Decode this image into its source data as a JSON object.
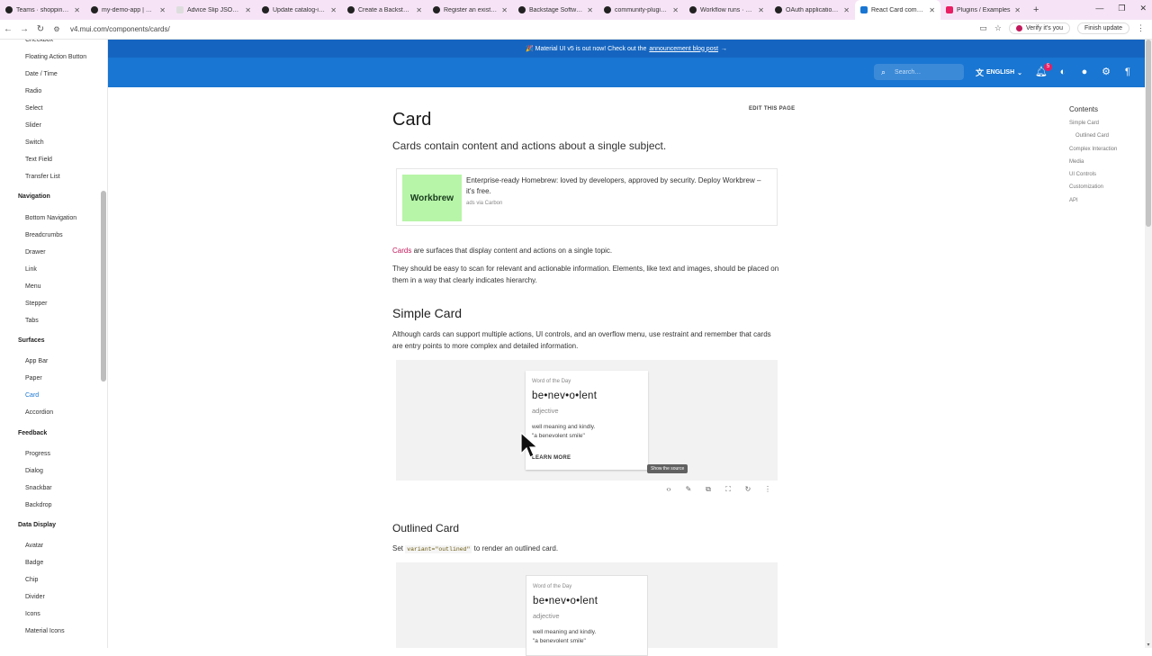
{
  "browser": {
    "tabs": [
      {
        "title": "Teams · shopping-hub",
        "icon": "github-icon"
      },
      {
        "title": "my-demo-app | Overview",
        "icon": "github-icon"
      },
      {
        "title": "Advice Slip JSON API",
        "icon": "blank-page-icon"
      },
      {
        "title": "Update catalog-info.yaml",
        "icon": "github-icon"
      },
      {
        "title": "Create a Backstage Plugin",
        "icon": "backstage-icon"
      },
      {
        "title": "Register an existing component",
        "icon": "backstage-icon"
      },
      {
        "title": "Backstage Software Catalog",
        "icon": "backstage-icon"
      },
      {
        "title": "community-plugins/workspaces",
        "icon": "github-icon"
      },
      {
        "title": "Workflow runs · Sanjeev",
        "icon": "github-icon"
      },
      {
        "title": "OAuth application settings",
        "icon": "github-icon"
      },
      {
        "title": "React Card component",
        "icon": "mui-icon",
        "active": true
      },
      {
        "title": "Plugins / Examples",
        "icon": "figma-icon"
      }
    ],
    "url": "v4.mui.com/components/cards/",
    "verify_label": "Verify it's you",
    "finish_update_label": "Finish update"
  },
  "banner": {
    "prefix": "🎉 Material UI v5 is out now! Check out the",
    "link": "announcement blog post",
    "suffix": "→"
  },
  "appbar": {
    "search_placeholder": "Search…",
    "language": "ENGLISH",
    "notifications_count": "5"
  },
  "sidenav": {
    "items": [
      {
        "label": "Checkbox",
        "type": "item"
      },
      {
        "label": "Floating Action Button",
        "type": "item"
      },
      {
        "label": "Date / Time",
        "type": "item"
      },
      {
        "label": "Radio",
        "type": "item"
      },
      {
        "label": "Select",
        "type": "item"
      },
      {
        "label": "Slider",
        "type": "item"
      },
      {
        "label": "Switch",
        "type": "item"
      },
      {
        "label": "Text Field",
        "type": "item"
      },
      {
        "label": "Transfer List",
        "type": "item"
      },
      {
        "label": "Navigation",
        "type": "group"
      },
      {
        "label": "Bottom Navigation",
        "type": "item"
      },
      {
        "label": "Breadcrumbs",
        "type": "item"
      },
      {
        "label": "Drawer",
        "type": "item"
      },
      {
        "label": "Link",
        "type": "item"
      },
      {
        "label": "Menu",
        "type": "item"
      },
      {
        "label": "Stepper",
        "type": "item"
      },
      {
        "label": "Tabs",
        "type": "item"
      },
      {
        "label": "Surfaces",
        "type": "group"
      },
      {
        "label": "App Bar",
        "type": "item"
      },
      {
        "label": "Paper",
        "type": "item"
      },
      {
        "label": "Card",
        "type": "item",
        "active": true
      },
      {
        "label": "Accordion",
        "type": "item"
      },
      {
        "label": "Feedback",
        "type": "group"
      },
      {
        "label": "Progress",
        "type": "item"
      },
      {
        "label": "Dialog",
        "type": "item"
      },
      {
        "label": "Snackbar",
        "type": "item"
      },
      {
        "label": "Backdrop",
        "type": "item"
      },
      {
        "label": "Data Display",
        "type": "group"
      },
      {
        "label": "Avatar",
        "type": "item"
      },
      {
        "label": "Badge",
        "type": "item"
      },
      {
        "label": "Chip",
        "type": "item"
      },
      {
        "label": "Divider",
        "type": "item"
      },
      {
        "label": "Icons",
        "type": "item"
      },
      {
        "label": "Material Icons",
        "type": "item"
      }
    ]
  },
  "main": {
    "title": "Card",
    "edit_label": "EDIT THIS PAGE",
    "lead": "Cards contain content and actions about a single subject.",
    "ad": {
      "logo_text": "Workbrew",
      "text": "Enterprise-ready Homebrew: loved by developers, approved by security. Deploy Workbrew – it's free.",
      "via": "ads via Carbon"
    },
    "intro_link": "Cards",
    "intro_rest": " are surfaces that display content and actions on a single topic.",
    "intro_p2": "They should be easy to scan for relevant and actionable information. Elements, like text and images, should be placed on them in a way that clearly indicates hierarchy.",
    "simple_heading": "Simple Card",
    "simple_desc": "Although cards can support multiple actions, UI controls, and an overflow menu, use restraint and remember that cards are entry points to more complex and detailed information.",
    "outlined_heading": "Outlined Card",
    "outlined_desc_prefix": "Set ",
    "outlined_code": "variant=\"outlined\"",
    "outlined_desc_suffix": " to render an outlined card.",
    "card": {
      "overline": "Word of the Day",
      "word": "be•nev•o•lent",
      "pos": "adjective",
      "def1": "well meaning and kindly.",
      "def2": "\"a benevolent smile\"",
      "action": "LEARN MORE"
    },
    "tooltip": "Show the source",
    "toolbar_icons": [
      "code-icon",
      "edit-icon",
      "copy-icon",
      "fullscreen-icon",
      "reset-icon",
      "more-icon"
    ]
  },
  "toc": {
    "title": "Contents",
    "items": [
      {
        "label": "Simple Card",
        "sub": false
      },
      {
        "label": "Outlined Card",
        "sub": true
      },
      {
        "label": "Complex Interaction",
        "sub": false
      },
      {
        "label": "Media",
        "sub": false
      },
      {
        "label": "UI Controls",
        "sub": false
      },
      {
        "label": "Customization",
        "sub": false
      },
      {
        "label": "API",
        "sub": false
      }
    ]
  },
  "colors": {
    "primary": "#1976d2",
    "banner": "#1565c0",
    "link_pink": "#c2185b",
    "ad_green": "#b7f5a8"
  }
}
